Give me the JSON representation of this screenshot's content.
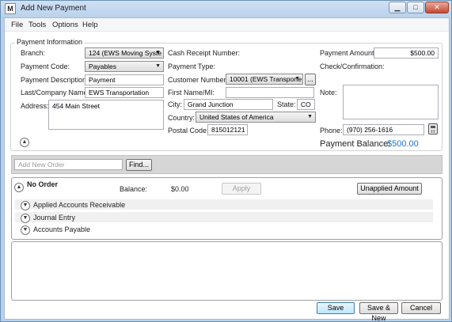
{
  "window": {
    "app_icon": "M",
    "title": "Add New Payment",
    "buttons": {
      "minimize": "▁",
      "maximize": "□",
      "close": "✕"
    }
  },
  "menu": [
    "File",
    "Tools",
    "Options",
    "Help"
  ],
  "payment_info": {
    "group_label": "Payment Information",
    "branch_label": "Branch:",
    "branch_value": "124 (EWS Moving Syste",
    "payment_code_label": "Payment Code:",
    "payment_code_value": "Payables",
    "payment_description_label": "Payment Description:",
    "payment_description_value": "Payment",
    "company_name_label": "Last/Company Name:",
    "company_name_value": "EWS Transportation",
    "address_label": "Address:",
    "address_value": "454 Main Street",
    "cash_receipt_label": "Cash Receipt Number:",
    "payment_type_label": "Payment Type:",
    "customer_number_label": "Customer Number:",
    "customer_number_value": "10001 (EWS Transporte",
    "ellipsis_button": "...",
    "first_name_label": "First Name/MI:",
    "city_label": "City:",
    "city_value": "Grand Junction",
    "state_label": "State:",
    "state_value": "CO",
    "country_label": "Country:",
    "country_value": "United States of America",
    "postal_code_label": "Postal Code:",
    "postal_code_value": "815012121",
    "payment_amount_label": "Payment Amount:",
    "payment_amount_value": "$500.00",
    "check_confirmation_label": "Check/Confirmation:",
    "note_label": "Note:",
    "phone_label": "Phone:",
    "phone_value": "(970) 256-1616",
    "payment_balance_label": "Payment Balance:",
    "payment_balance_value": "$500.00"
  },
  "orders": {
    "add_order_placeholder": "Add New Order",
    "find_button": "Find...",
    "no_order_title": "No Order",
    "balance_label": "Balance:",
    "balance_value": "$0.00",
    "apply_button": "Apply",
    "unapplied_amount_button": "Unapplied Amount",
    "sections": [
      "Applied Accounts Receivable",
      "Journal Entry",
      "Accounts Payable"
    ]
  },
  "footer": {
    "save": "Save",
    "save_new": "Save & New",
    "cancel": "Cancel"
  },
  "colors": {
    "balance_blue": "#1e73d2",
    "title_bar": "#c4d8ef"
  },
  "icons": {
    "expand": "chevron-down-icon",
    "collapse": "chevron-up-icon",
    "calculator": "calculator-icon"
  }
}
